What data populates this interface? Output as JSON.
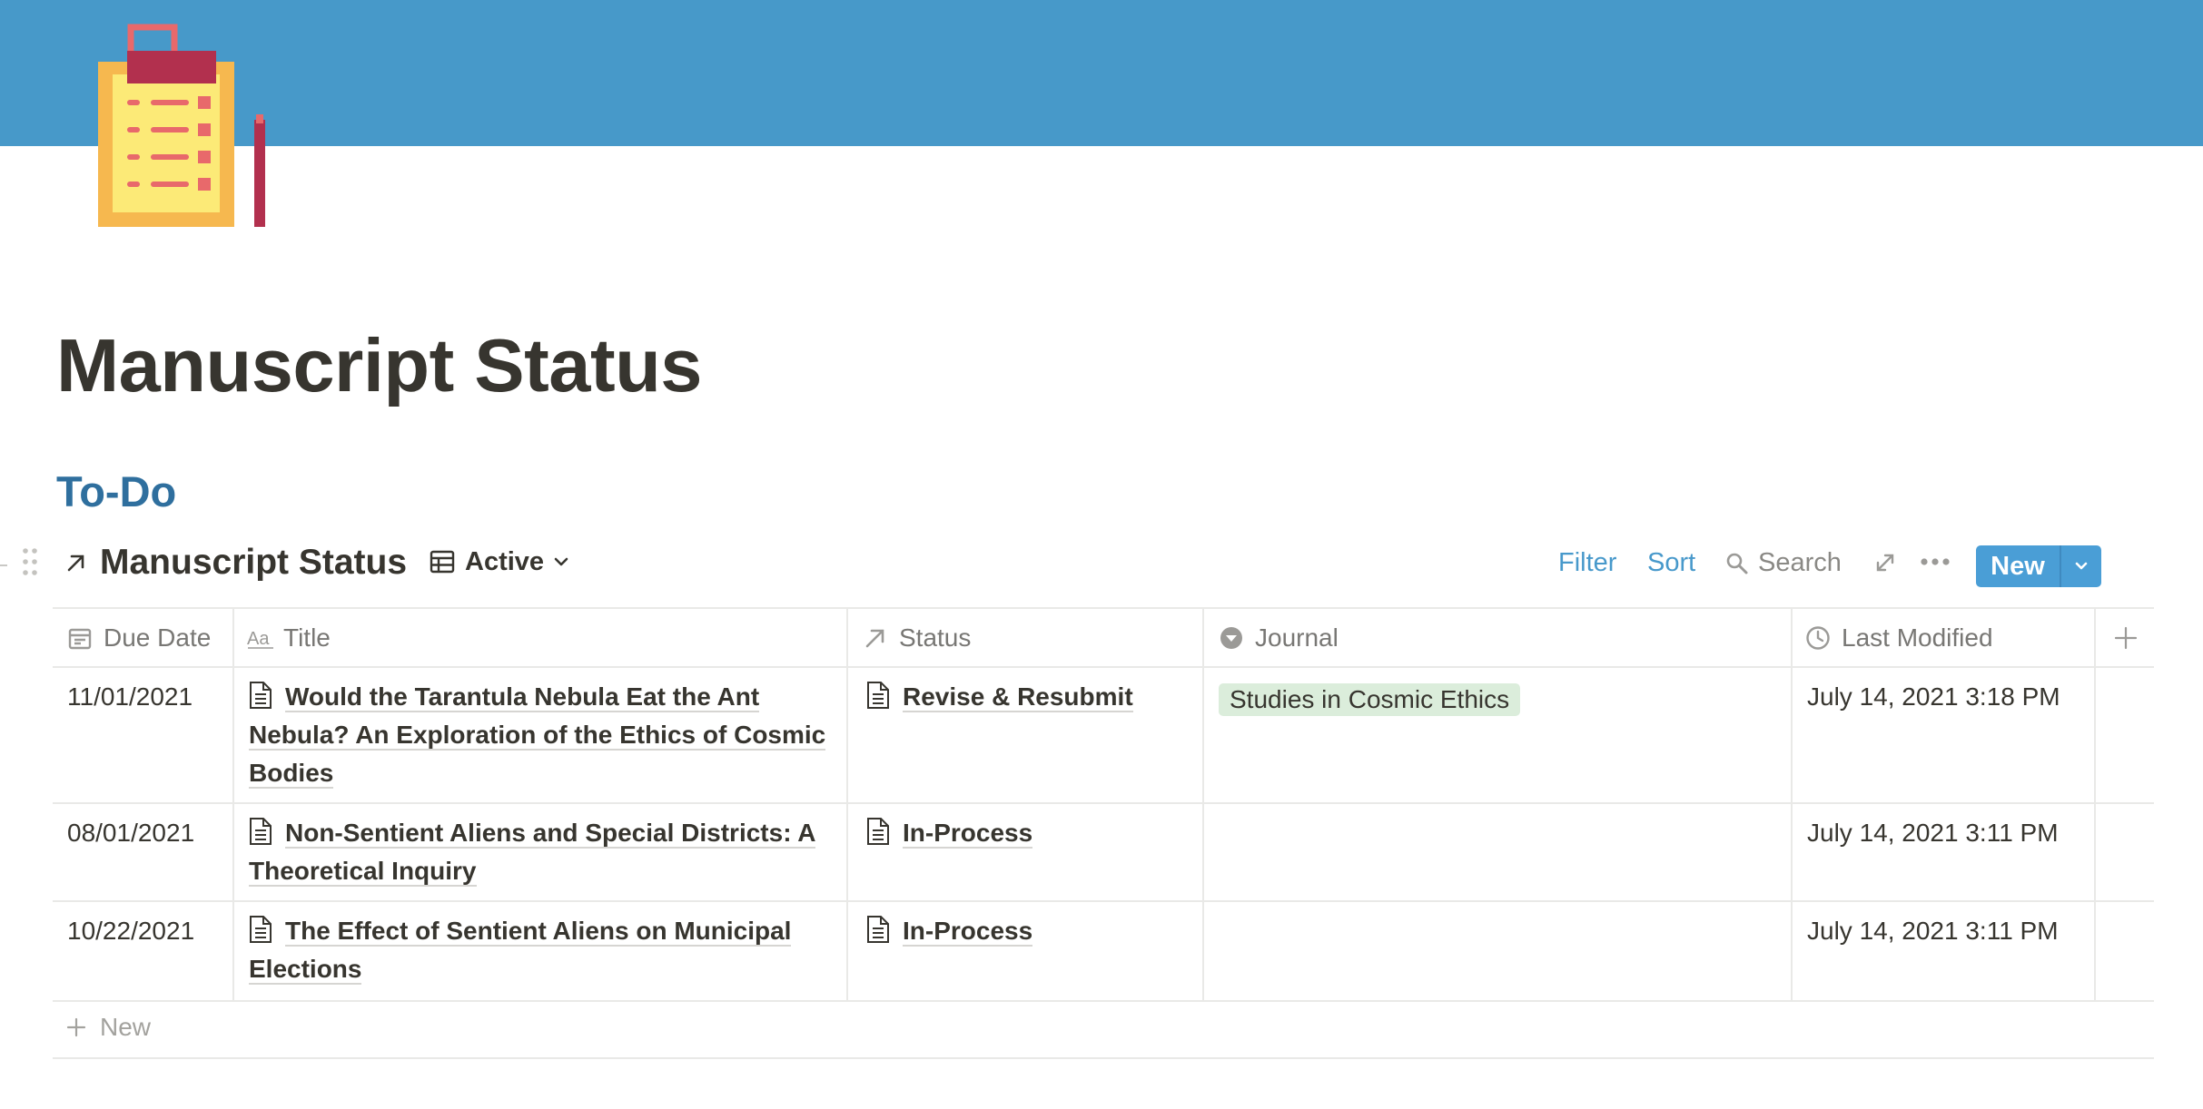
{
  "page": {
    "icon": "clipboard-checklist-icon",
    "title": "Manuscript Status",
    "cover_color": "#4799c9"
  },
  "section": {
    "heading": "To-Do",
    "heading_color": "#2f6f9e"
  },
  "database": {
    "title": "Manuscript Status",
    "view_label": "Active",
    "toolbar": {
      "filter": "Filter",
      "sort": "Sort",
      "search": "Search",
      "new": "New",
      "accent_color": "#4899cb"
    },
    "columns": [
      {
        "label": "Due Date",
        "icon": "calendar-icon"
      },
      {
        "label": "Title",
        "icon": "text-aa-icon"
      },
      {
        "label": "Status",
        "icon": "relation-arrow-icon"
      },
      {
        "label": "Journal",
        "icon": "select-dropdown-icon"
      },
      {
        "label": "Last Modified",
        "icon": "clock-icon"
      }
    ],
    "rows": [
      {
        "due_date": "11/01/2021",
        "title": "Would the Tarantula Nebula Eat the Ant Nebula? An Exploration of the Ethics of Cosmic Bodies",
        "status": "Revise & Resubmit",
        "journal": "Studies in Cosmic Ethics",
        "last_modified": "July 14, 2021 3:18 PM"
      },
      {
        "due_date": "08/01/2021",
        "title": "Non-Sentient Aliens and Special Districts: A Theoretical Inquiry",
        "status": "In-Process",
        "journal": "",
        "last_modified": "July 14, 2021 3:11 PM"
      },
      {
        "due_date": "10/22/2021",
        "title": "The Effect of Sentient Aliens on Municipal Elections",
        "status": "In-Process",
        "journal": "",
        "last_modified": "July 14, 2021 3:11 PM"
      }
    ],
    "new_row_label": "New",
    "journal_tag_color": "#dbeddb"
  }
}
